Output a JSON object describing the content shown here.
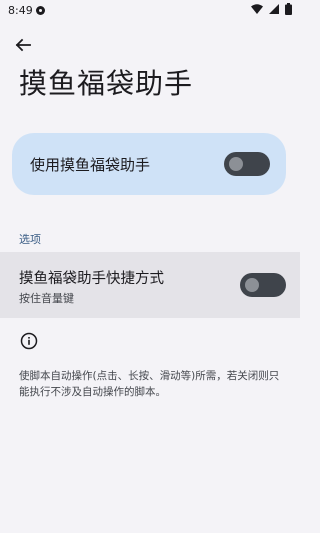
{
  "status_bar": {
    "time": "8:49",
    "icons": [
      "app-notification-icon",
      "wifi-icon",
      "cell-signal-icon",
      "battery-icon"
    ]
  },
  "header": {
    "back_icon": "arrow-back-icon",
    "title": "摸鱼福袋助手"
  },
  "main_toggle": {
    "label": "使用摸鱼福袋助手",
    "enabled": false
  },
  "options_section": {
    "header": "选项",
    "shortcut": {
      "title": "摸鱼福袋助手快捷方式",
      "summary": "按住音量键",
      "enabled": false
    }
  },
  "footer": {
    "icon": "info-icon",
    "text": "使脚本自动操作(点击、长按、滑动等)所需，若关闭则只能执行不涉及自动操作的脚本。"
  },
  "colors": {
    "background": "#f4f3f7",
    "card": "#cfe2f7",
    "accent_text": "#3b5e86",
    "switch_track": "#3f444b",
    "switch_thumb": "#8c9096"
  }
}
